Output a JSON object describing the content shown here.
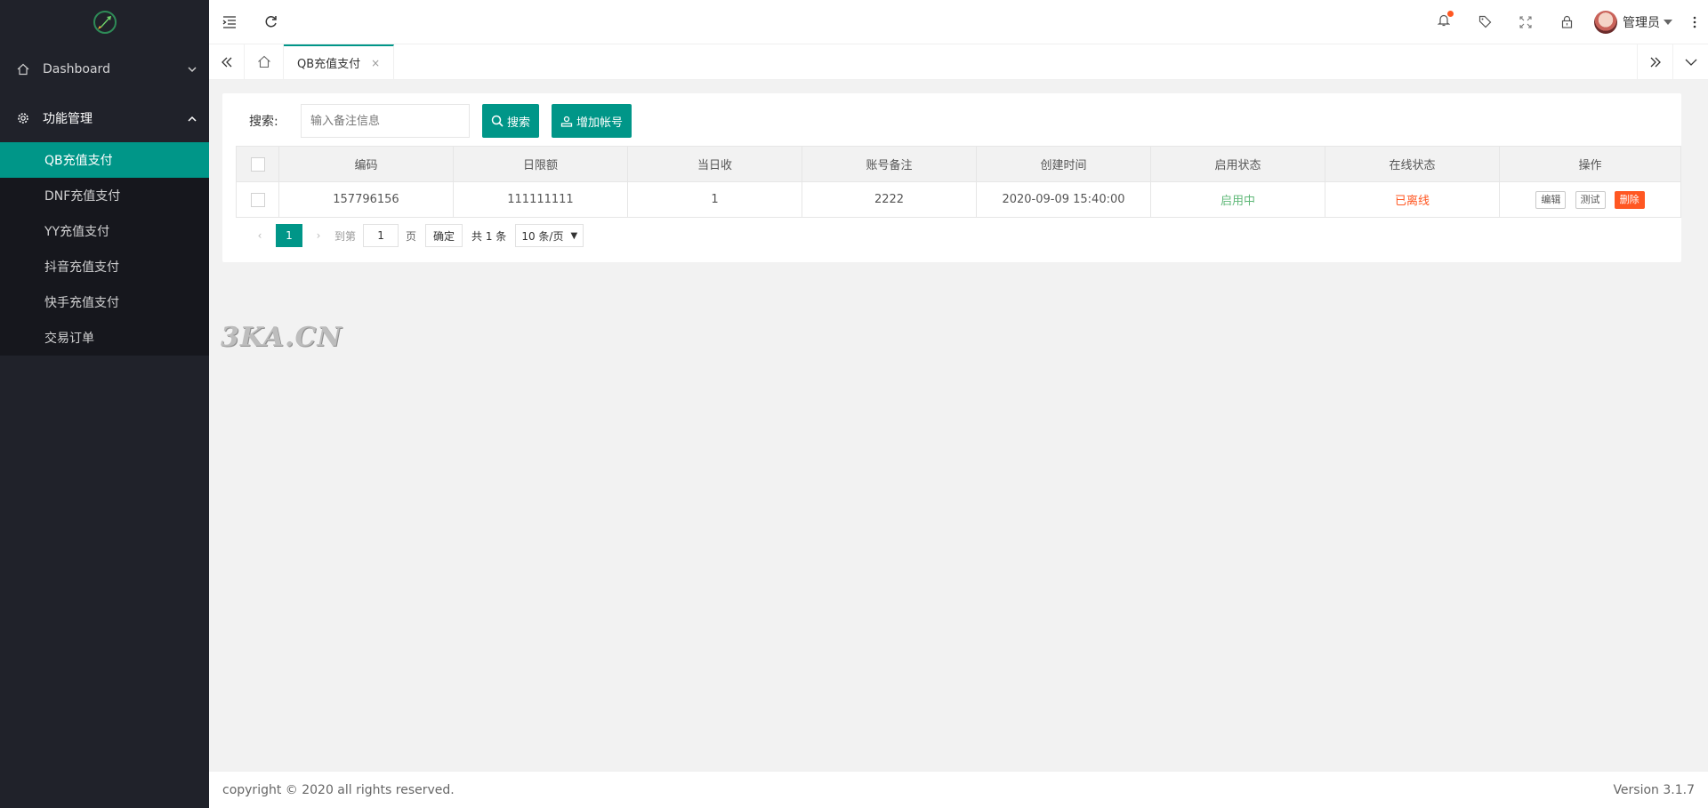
{
  "sidebar": {
    "logo": "rocket-logo",
    "sections": [
      {
        "label": "Dashboard",
        "icon": "home-icon",
        "expanded": false
      },
      {
        "label": "功能管理",
        "icon": "gear-icon",
        "expanded": true
      }
    ],
    "items": [
      {
        "label": "QB充值支付",
        "selected": true
      },
      {
        "label": "DNF充值支付"
      },
      {
        "label": "YY充值支付"
      },
      {
        "label": "抖音充值支付"
      },
      {
        "label": "快手充值支付"
      },
      {
        "label": "交易订单"
      }
    ]
  },
  "header": {
    "user_name": "管理员"
  },
  "tabs": {
    "active_label": "QB充值支付",
    "close_glyph": "×"
  },
  "search": {
    "label": "搜索:",
    "placeholder": "输入备注信息",
    "search_button": "搜索",
    "add_button": "增加帐号"
  },
  "table": {
    "columns": [
      "编码",
      "日限额",
      "当日收",
      "账号备注",
      "创建时间",
      "启用状态",
      "在线状态",
      "操作"
    ],
    "rows": [
      {
        "code": "157796156",
        "daily_limit": "111111111",
        "today_income": "1",
        "remark": "2222",
        "created": "2020-09-09 15:40:00",
        "enabled": "启用中",
        "online": "已离线",
        "actions": [
          "编辑",
          "测试",
          "删除"
        ]
      }
    ]
  },
  "pager": {
    "current": "1",
    "goto_label": "到第",
    "page_input": "1",
    "page_suffix": "页",
    "confirm": "确定",
    "total": "共 1 条",
    "page_size": "10 条/页"
  },
  "watermark": "3KA.CN",
  "footer": {
    "copyright": "copyright © 2020 all rights reserved.",
    "version": "Version 3.1.7"
  },
  "colors": {
    "accent": "#009688",
    "sidebar_bg": "#20222a",
    "danger": "#ff5722",
    "success": "#5FB878"
  }
}
